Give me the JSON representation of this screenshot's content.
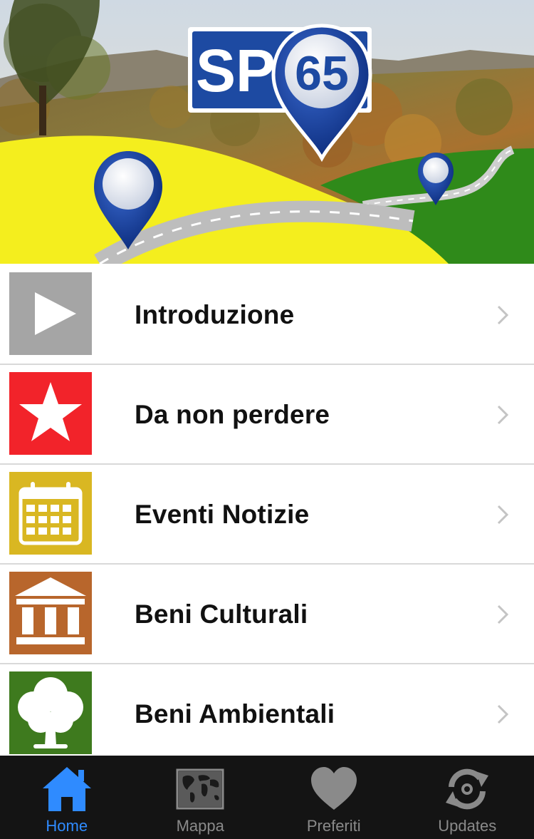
{
  "header": {
    "logo_text_prefix": "SP",
    "logo_text_number": "65",
    "logo_brand_color": "#1d4aa2"
  },
  "menu": {
    "items": [
      {
        "label": "Introduzione",
        "icon": "play-icon",
        "icon_bg": "#a5a5a5"
      },
      {
        "label": "Da non perdere",
        "icon": "star-icon",
        "icon_bg": "#f2232a"
      },
      {
        "label": "Eventi Notizie",
        "icon": "calendar-icon",
        "icon_bg": "#d9b722"
      },
      {
        "label": "Beni Culturali",
        "icon": "museum-icon",
        "icon_bg": "#b8662c"
      },
      {
        "label": "Beni Ambientali",
        "icon": "tree-icon",
        "icon_bg": "#3e7a1e"
      }
    ]
  },
  "tabbar": {
    "active_color": "#2f8bff",
    "inactive_color": "#8a8a8a",
    "tabs": [
      {
        "label": "Home",
        "icon": "home-icon",
        "active": true
      },
      {
        "label": "Mappa",
        "icon": "world-map-icon",
        "active": false
      },
      {
        "label": "Preferiti",
        "icon": "heart-icon",
        "active": false
      },
      {
        "label": "Updates",
        "icon": "refresh-icon",
        "active": false
      }
    ]
  }
}
